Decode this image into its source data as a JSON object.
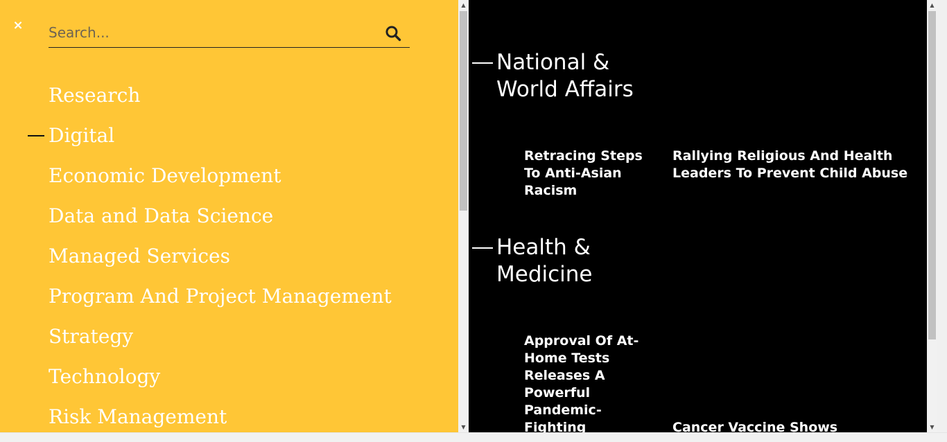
{
  "menu": {
    "close_glyph": "×",
    "search_placeholder": "Search...",
    "items": [
      {
        "label": "Research"
      },
      {
        "label": "Digital"
      },
      {
        "label": "Economic Development"
      },
      {
        "label": "Data and Data Science"
      },
      {
        "label": "Managed Services"
      },
      {
        "label": "Program And Project Management"
      },
      {
        "label": "Strategy"
      },
      {
        "label": "Technology"
      },
      {
        "label": "Risk Management"
      }
    ]
  },
  "sections": [
    {
      "title_line1": "National &",
      "title_line2": "World Affairs",
      "articles": [
        {
          "title": "Retracing Steps To Anti-Asian Racism"
        },
        {
          "title": "Rallying Religious And Health Leaders To Prevent Child Abuse"
        }
      ]
    },
    {
      "title_line1": "Health &",
      "title_line2": "Medicine",
      "articles": [
        {
          "title": "Approval Of At-Home Tests Releases A Powerful Pandemic-Fighting"
        },
        {
          "title": "Cancer Vaccine Shows"
        }
      ]
    }
  ],
  "colors": {
    "menu_bg": "#FFC636",
    "content_bg": "#000000",
    "text": "#FFFFFF"
  },
  "icons": {
    "close": "close-icon",
    "search": "search-icon",
    "scroll_up": "chevron-up-icon",
    "scroll_down": "chevron-down-icon"
  }
}
